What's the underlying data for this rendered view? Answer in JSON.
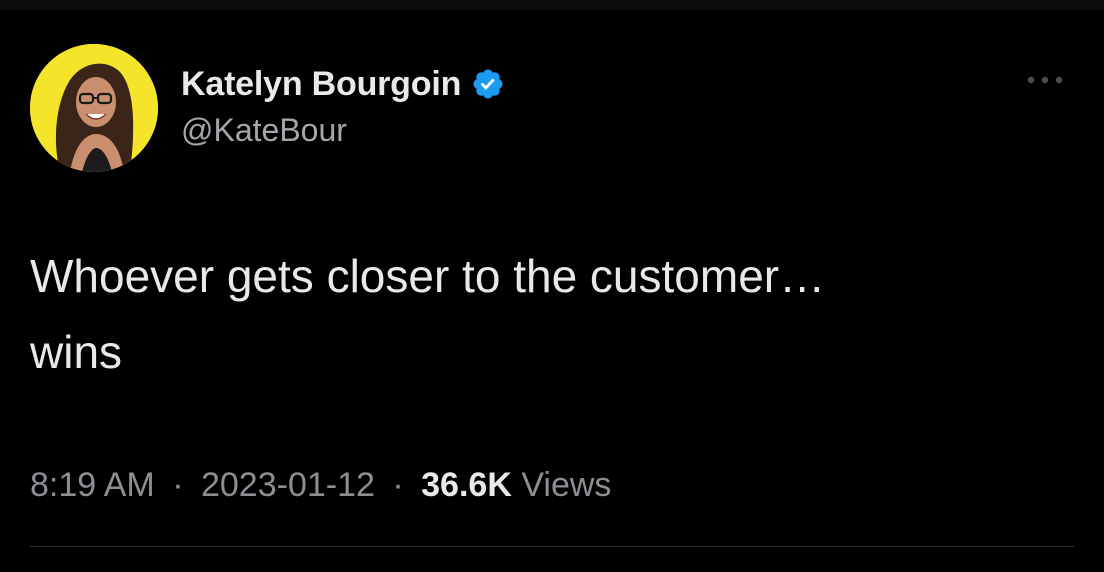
{
  "tweet": {
    "author": {
      "display_name": "Katelyn Bourgoin",
      "handle": "@KateBour",
      "verified_icon": "verified-badge-icon",
      "avatar_background": "#f5e52a"
    },
    "text": "Whoever gets closer to the customer…\nwins",
    "time": "8:19 AM",
    "separator": "·",
    "date": "2023-01-12",
    "views_count": "36.6K",
    "views_label": "Views",
    "more_icon": "more-options-icon"
  },
  "colors": {
    "background": "#000000",
    "text_primary": "#e7e9ea",
    "text_secondary": "#8b8f93",
    "verified_blue": "#1d9bf0"
  }
}
